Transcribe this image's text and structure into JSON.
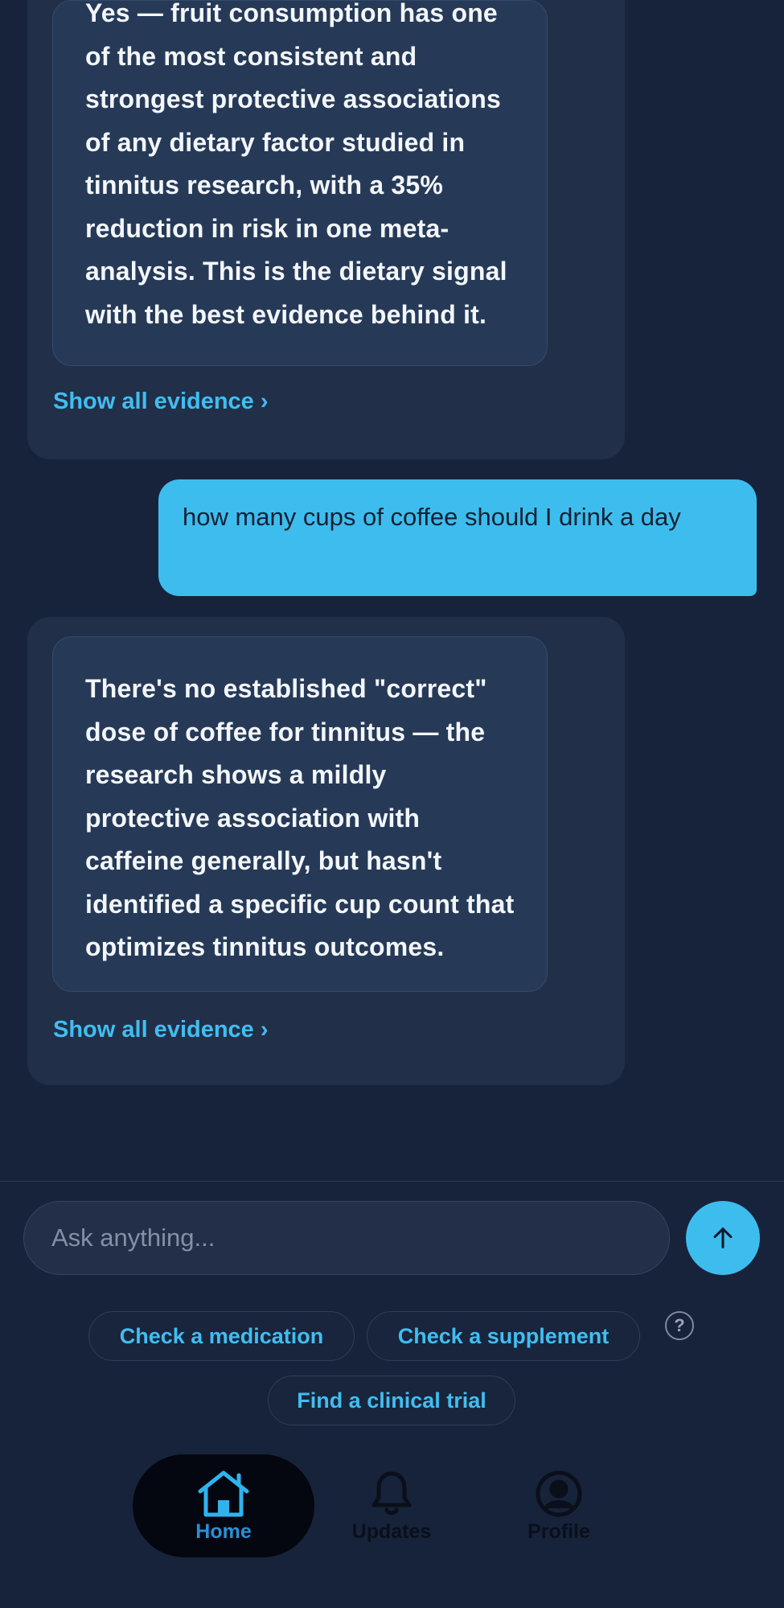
{
  "conversation": {
    "messages": [
      {
        "role": "assistant",
        "answer": "Yes — fruit consumption has one of the most consistent and strongest protective associations of any dietary factor studied in tinnitus research, with a 35% reduction in risk in one meta-analysis. This is the dietary signal with the best evidence behind it.",
        "evidence_link": "Show all evidence ›"
      },
      {
        "role": "user",
        "text": "how many cups of coffee should I drink a day"
      },
      {
        "role": "assistant",
        "answer": "There's no established \"correct\" dose of coffee for tinnitus — the research shows a mildly protective association with caffeine generally, but hasn't identified a specific cup count that optimizes tinnitus outcomes.",
        "evidence_link": "Show all evidence ›"
      }
    ]
  },
  "composer": {
    "placeholder": "Ask anything...",
    "send_icon": "arrow-up-icon"
  },
  "quick_actions": {
    "chips": [
      "Check a medication",
      "Check a supplement",
      "Find a clinical trial"
    ],
    "help_label": "?"
  },
  "bottom_nav": {
    "items": [
      {
        "label": "Home",
        "icon": "home-icon",
        "active": true
      },
      {
        "label": "Updates",
        "icon": "bell-icon",
        "active": false
      },
      {
        "label": "Profile",
        "icon": "profile-icon",
        "active": false
      }
    ]
  },
  "colors": {
    "background": "#17233b",
    "accent": "#3dbdee",
    "card": "#212f49",
    "answer_box": "#263a58"
  }
}
